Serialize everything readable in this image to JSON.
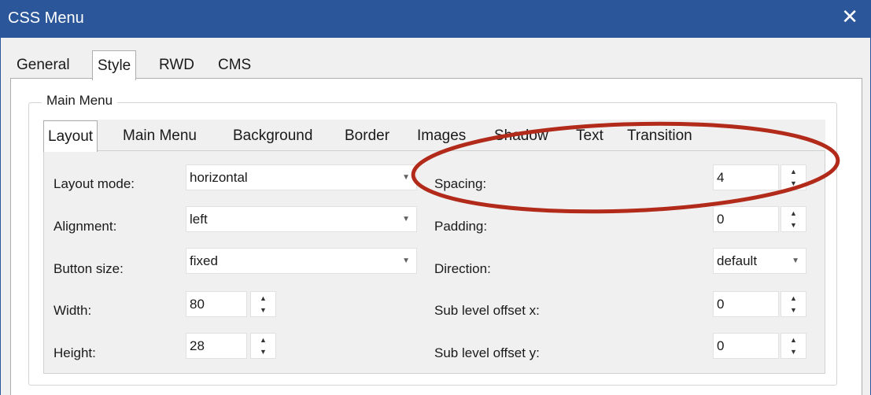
{
  "window": {
    "title": "CSS Menu",
    "close_glyph": "✕"
  },
  "outer_tabs": [
    {
      "label": "General",
      "active": false
    },
    {
      "label": "Style",
      "active": true
    },
    {
      "label": "RWD",
      "active": false
    },
    {
      "label": "CMS",
      "active": false
    }
  ],
  "group": {
    "label": "Main Menu"
  },
  "inner_tabs": [
    {
      "label": "Layout",
      "active": true
    },
    {
      "label": "Main Menu",
      "active": false
    },
    {
      "label": "Background",
      "active": false
    },
    {
      "label": "Border",
      "active": false
    },
    {
      "label": "Images",
      "active": false
    },
    {
      "label": "Shadow",
      "active": false
    },
    {
      "label": "Text",
      "active": false
    },
    {
      "label": "Transition",
      "active": false
    }
  ],
  "fields": {
    "layout_mode": {
      "label": "Layout mode:",
      "value": "horizontal"
    },
    "alignment": {
      "label": "Alignment:",
      "value": "left"
    },
    "button_size": {
      "label": "Button size:",
      "value": "fixed"
    },
    "width": {
      "label": "Width:",
      "value": "80"
    },
    "height": {
      "label": "Height:",
      "value": "28"
    },
    "spacing": {
      "label": "Spacing:",
      "value": "4"
    },
    "padding": {
      "label": "Padding:",
      "value": "0"
    },
    "direction": {
      "label": "Direction:",
      "value": "default"
    },
    "sub_offset_x": {
      "label": "Sub level offset x:",
      "value": "0"
    },
    "sub_offset_y": {
      "label": "Sub level offset y:",
      "value": "0"
    }
  },
  "glyphs": {
    "caret": "▼",
    "spin_up": "▲",
    "spin_down": "▼"
  },
  "colors": {
    "titlebar": "#2b579a",
    "annotation": "#b22a1a"
  },
  "icons": {
    "close": "close-icon",
    "dropdown": "chevron-down-icon",
    "spinner": "spinner-arrows-icon"
  }
}
